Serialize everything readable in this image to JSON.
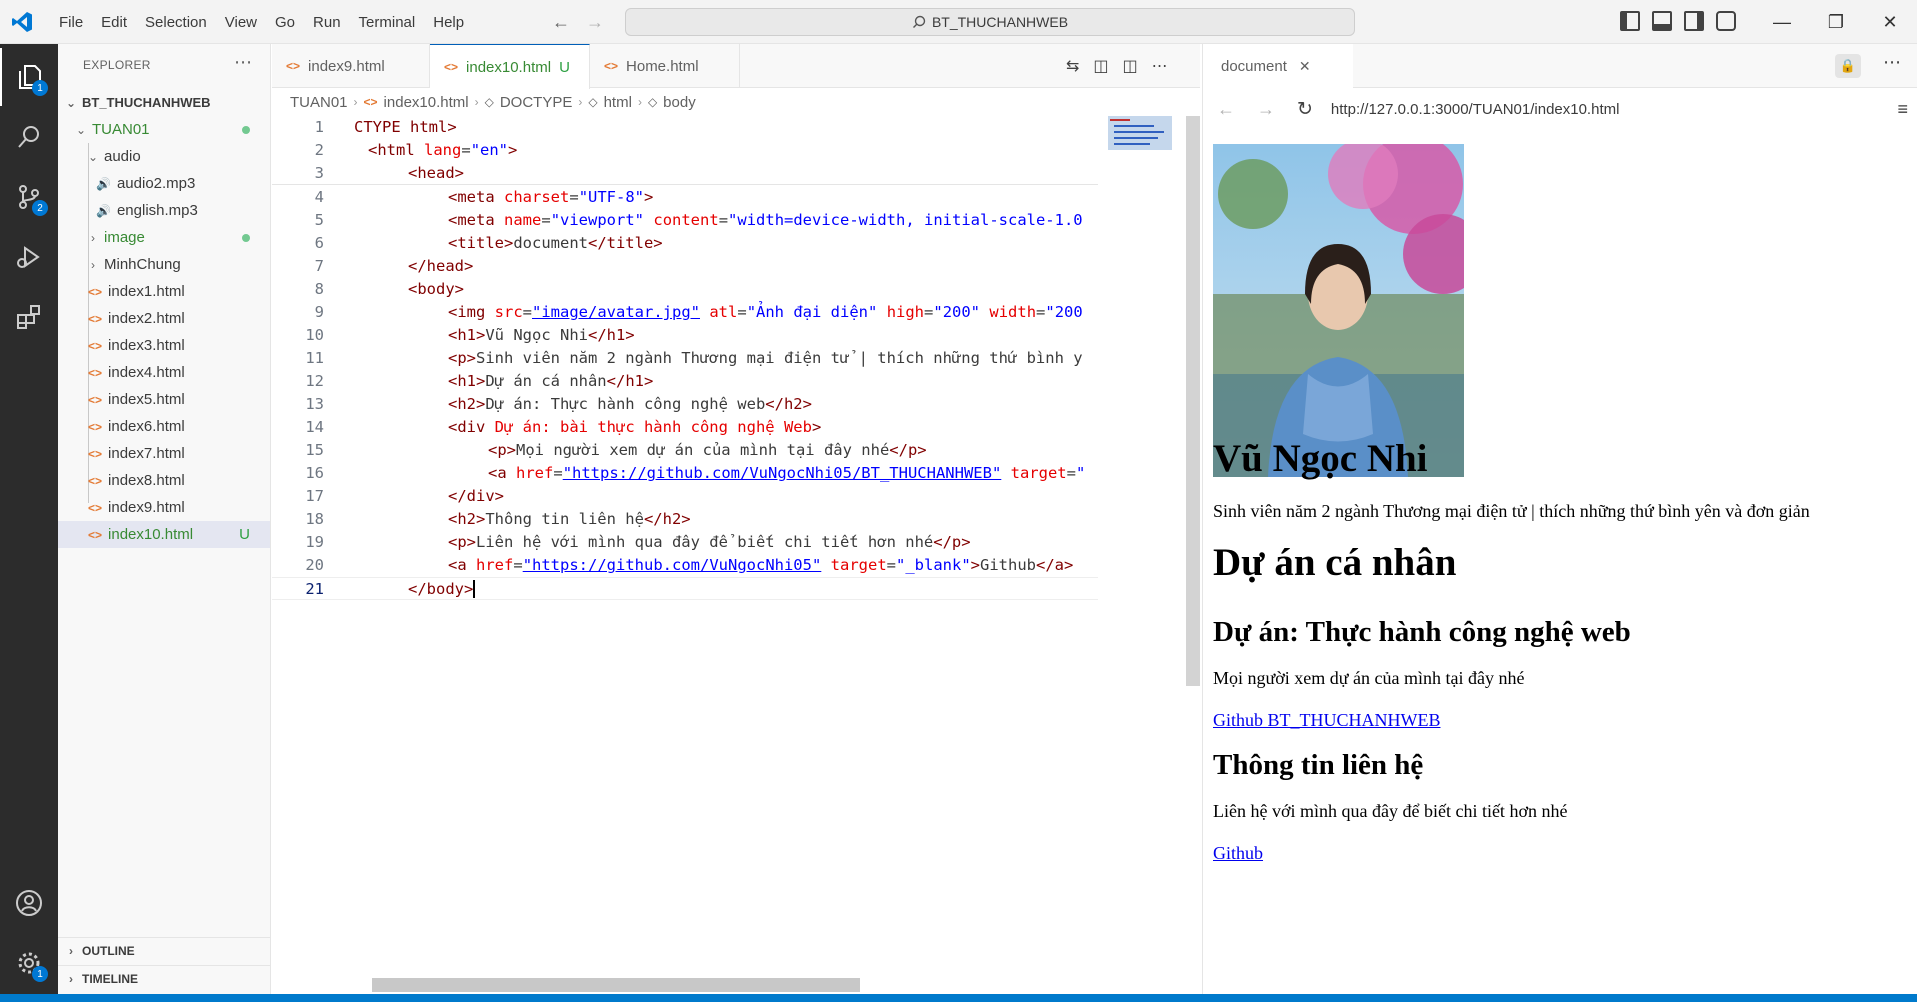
{
  "menu": [
    "File",
    "Edit",
    "Selection",
    "View",
    "Go",
    "Run",
    "Terminal",
    "Help"
  ],
  "command_center": "BT_THUCHANHWEB",
  "activity_badges": {
    "explorer": "1",
    "scm": "2",
    "settings": "1"
  },
  "explorer": {
    "title": "EXPLORER",
    "root": "BT_THUCHANHWEB",
    "items": [
      {
        "label": "TUAN01",
        "kind": "folder"
      },
      {
        "label": "audio",
        "kind": "folder"
      },
      {
        "label": "audio2.mp3",
        "kind": "audio"
      },
      {
        "label": "english.mp3",
        "kind": "audio"
      },
      {
        "label": "image",
        "kind": "folder"
      },
      {
        "label": "MinhChung",
        "kind": "folder"
      },
      {
        "label": "index1.html",
        "kind": "html"
      },
      {
        "label": "index2.html",
        "kind": "html"
      },
      {
        "label": "index3.html",
        "kind": "html"
      },
      {
        "label": "index4.html",
        "kind": "html"
      },
      {
        "label": "index5.html",
        "kind": "html"
      },
      {
        "label": "index6.html",
        "kind": "html"
      },
      {
        "label": "index7.html",
        "kind": "html"
      },
      {
        "label": "index8.html",
        "kind": "html"
      },
      {
        "label": "index9.html",
        "kind": "html"
      },
      {
        "label": "index10.html",
        "kind": "html",
        "status": "U"
      }
    ],
    "outline": "OUTLINE",
    "timeline": "TIMELINE"
  },
  "tabs": [
    {
      "label": "index9.html"
    },
    {
      "label": "index10.html",
      "status": "U"
    },
    {
      "label": "Home.html"
    }
  ],
  "breadcrumb": [
    "TUAN01",
    "index10.html",
    "DOCTYPE",
    "html",
    "body"
  ],
  "code": {
    "line_numbers": [
      "1",
      "2",
      "3",
      "4",
      "5",
      "6",
      "7",
      "8",
      "9",
      "10",
      "11",
      "12",
      "13",
      "14",
      "15",
      "16",
      "17",
      "18",
      "19",
      "20",
      "21"
    ]
  },
  "preview": {
    "tab_title": "document",
    "url": "http://127.0.0.1:3000/TUAN01/index10.html",
    "h1_name": "Vũ Ngọc Nhi",
    "bio": "Sinh viên năm 2 ngành Thương mại điện tử | thích những thứ bình yên và đơn giản",
    "h1_project": "Dự án cá nhân",
    "h2_project": "Dự án: Thực hành công nghệ web",
    "project_text": "Mọi người xem dự án của mình tại đây nhé",
    "project_link": "Github BT_THUCHANHWEB",
    "h2_contact": "Thông tin liên hệ",
    "contact_text": "Liên hệ với mình qua đây để biết chi tiết hơn nhé",
    "contact_link": "Github"
  }
}
